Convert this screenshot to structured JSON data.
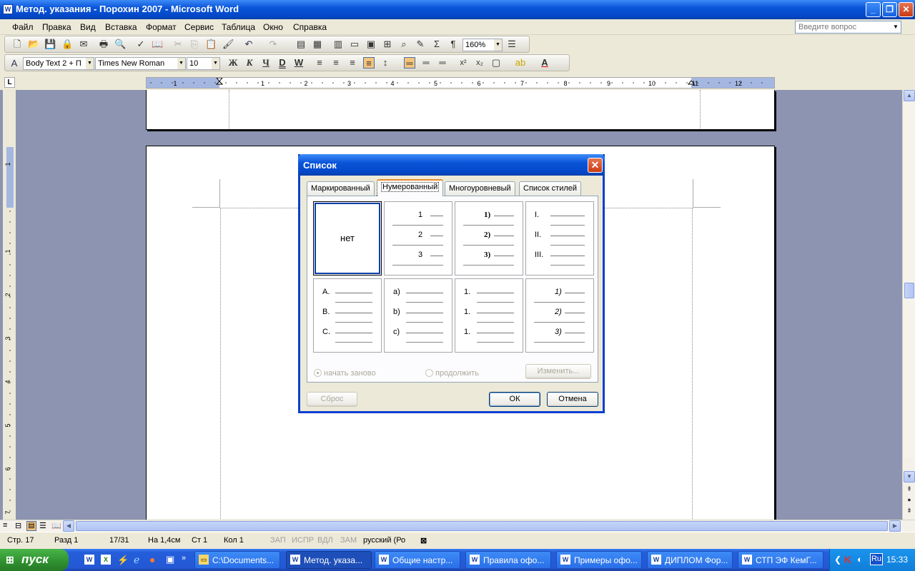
{
  "window": {
    "title": "Метод. указания - Порохин 2007 - Microsoft Word",
    "app_icon": "W"
  },
  "menu": {
    "items": [
      "Файл",
      "Правка",
      "Вид",
      "Вставка",
      "Формат",
      "Сервис",
      "Таблица",
      "Окно",
      "Справка"
    ],
    "ask_placeholder": "Введите вопрос"
  },
  "toolbar": {
    "zoom": "160%",
    "style": "Body Text 2 + П",
    "font": "Times New Roman",
    "size": "10",
    "bold": "Ж",
    "italic": "К",
    "underline": "Ч",
    "double_underline": "D",
    "word_underline": "W"
  },
  "ruler": {
    "numbers": [
      "1",
      "1",
      "2",
      "3",
      "4",
      "5",
      "6",
      "7",
      "8",
      "9",
      "10",
      "11",
      "12"
    ],
    "vnumbers": [
      "1",
      "1",
      "2",
      "3",
      "4",
      "5",
      "6",
      "7"
    ]
  },
  "dialog": {
    "title": "Список",
    "tabs": [
      "Маркированный",
      "Нумерованный",
      "Многоуровневый",
      "Список стилей"
    ],
    "selected_tab": "Нумерованный",
    "none_label": "нет",
    "styles": [
      [
        "1",
        "2",
        "3"
      ],
      [
        "1)",
        "2)",
        "3)"
      ],
      [
        "I.",
        "II.",
        "III."
      ],
      [
        "A.",
        "B.",
        "C."
      ],
      [
        "a)",
        "b)",
        "c)"
      ],
      [
        "1.",
        "1.",
        "1."
      ],
      [
        "1)",
        "2)",
        "3)"
      ]
    ],
    "restart_label": "начать заново",
    "continue_label": "продолжить",
    "modify_label": "Изменить...",
    "reset_label": "Сброс",
    "ok_label": "ОК",
    "cancel_label": "Отмена"
  },
  "status": {
    "page": "Стр. 17",
    "section": "Разд 1",
    "pages": "17/31",
    "at": "На 1,4см",
    "line": "Ст 1",
    "col": "Кол 1",
    "rec": "ЗАП",
    "trk": "ИСПР",
    "ext": "ВДЛ",
    "ovr": "ЗАМ",
    "lang": "русский (Ро"
  },
  "taskbar": {
    "start": "пуск",
    "tasks": [
      "C:\\Documents...",
      "Метод. указа...",
      "Общие настр...",
      "Правила офо...",
      "Примеры офо...",
      "ДИПЛОМ Фор...",
      "СТП ЭФ КемГ..."
    ],
    "lang": "Ru",
    "clock": "15:33"
  }
}
